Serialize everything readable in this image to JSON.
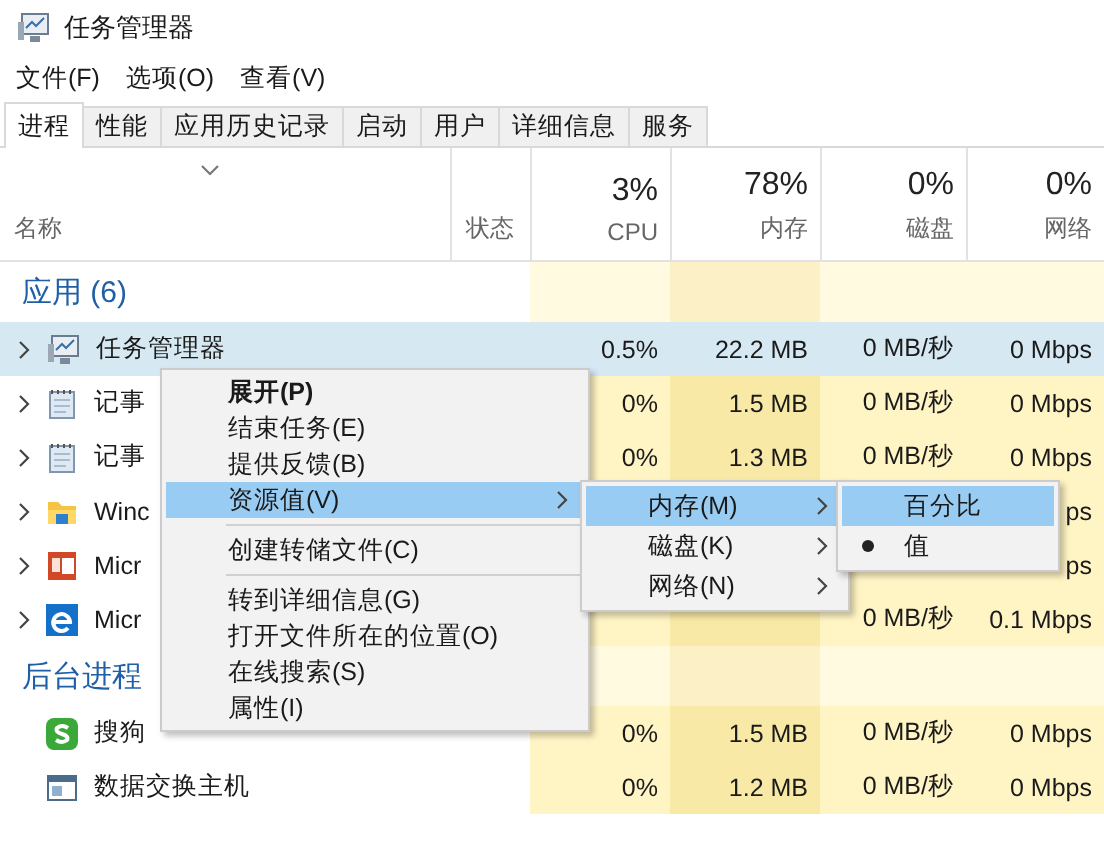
{
  "window": {
    "title": "任务管理器"
  },
  "menu_bar": [
    "文件(F)",
    "选项(O)",
    "查看(V)"
  ],
  "tabs": [
    {
      "label": "进程",
      "selected": true
    },
    {
      "label": "性能",
      "selected": false
    },
    {
      "label": "应用历史记录",
      "selected": false
    },
    {
      "label": "启动",
      "selected": false
    },
    {
      "label": "用户",
      "selected": false
    },
    {
      "label": "详细信息",
      "selected": false
    },
    {
      "label": "服务",
      "selected": false
    }
  ],
  "table": {
    "columns": [
      {
        "label": "名称"
      },
      {
        "label": "状态"
      },
      {
        "usage": "3%",
        "label": "CPU"
      },
      {
        "usage": "78%",
        "label": "内存"
      },
      {
        "usage": "0%",
        "label": "磁盘"
      },
      {
        "usage": "0%",
        "label": "网络"
      }
    ],
    "groups": [
      {
        "title": "应用 (6)",
        "rows": [
          {
            "name": "任务管理器",
            "kind": "monitor",
            "expandable": true,
            "selected": true,
            "cpu": "0.5%",
            "memory": "22.2 MB",
            "disk": "0 MB/秒",
            "network": "0 Mbps"
          },
          {
            "name": "记事",
            "kind": "notepad",
            "expandable": true,
            "selected": false,
            "cpu": "0%",
            "memory": "1.5 MB",
            "disk": "0 MB/秒",
            "network": "0 Mbps"
          },
          {
            "name": "记事",
            "kind": "notepad",
            "expandable": true,
            "selected": false,
            "cpu": "0%",
            "memory": "1.3 MB",
            "disk": "0 MB/秒",
            "network": "0 Mbps"
          },
          {
            "name": "Winc",
            "kind": "folder",
            "expandable": true,
            "selected": false,
            "network": "ps"
          },
          {
            "name": "Micr",
            "kind": "slides",
            "expandable": true,
            "selected": false,
            "network": "ps"
          },
          {
            "name": "Micr",
            "kind": "globe",
            "expandable": true,
            "selected": false,
            "disk": "0 MB/秒",
            "network": "0.1 Mbps"
          }
        ]
      },
      {
        "title": "后台进程",
        "rows": [
          {
            "name": "搜狗",
            "kind": "swirl",
            "expandable": false,
            "selected": false,
            "cpu": "0%",
            "memory": "1.5 MB",
            "disk": "0 MB/秒",
            "network": "0 Mbps"
          },
          {
            "name": "数据交换主机",
            "kind": "window",
            "expandable": false,
            "selected": false,
            "cpu": "0%",
            "memory": "1.2 MB",
            "disk": "0 MB/秒",
            "network": "0 Mbps"
          }
        ]
      }
    ]
  },
  "context_menu": {
    "items": [
      {
        "kind": "item",
        "label": "展开(P)",
        "bold": true,
        "selected": false,
        "has_submenu": false
      },
      {
        "kind": "item",
        "label": "结束任务(E)",
        "bold": false,
        "selected": false,
        "has_submenu": false
      },
      {
        "kind": "item",
        "label": "提供反馈(B)",
        "bold": false,
        "selected": false,
        "has_submenu": false
      },
      {
        "kind": "item",
        "label": "资源值(V)",
        "bold": false,
        "selected": true,
        "has_submenu": true
      },
      {
        "kind": "separator"
      },
      {
        "kind": "item",
        "label": "创建转储文件(C)",
        "bold": false,
        "selected": false,
        "has_submenu": false
      },
      {
        "kind": "separator"
      },
      {
        "kind": "item",
        "label": "转到详细信息(G)",
        "bold": false,
        "selected": false,
        "has_submenu": false
      },
      {
        "kind": "item",
        "label": "打开文件所在的位置(O)",
        "bold": false,
        "selected": false,
        "has_submenu": false
      },
      {
        "kind": "item",
        "label": "在线搜索(S)",
        "bold": false,
        "selected": false,
        "has_submenu": false
      },
      {
        "kind": "item",
        "label": "属性(I)",
        "bold": false,
        "selected": false,
        "has_submenu": false
      }
    ]
  },
  "submenu": {
    "items": [
      {
        "kind": "item",
        "label": "内存(M)",
        "selected": true,
        "has_submenu": true
      },
      {
        "kind": "item",
        "label": "磁盘(K)",
        "selected": false,
        "has_submenu": true
      },
      {
        "kind": "item",
        "label": "网络(N)",
        "selected": false,
        "has_submenu": true
      }
    ]
  },
  "submenu_2": {
    "items": [
      {
        "kind": "item",
        "label": "百分比",
        "selected": true,
        "checked": false
      },
      {
        "kind": "item",
        "label": "值",
        "selected": false,
        "checked": true
      }
    ]
  }
}
